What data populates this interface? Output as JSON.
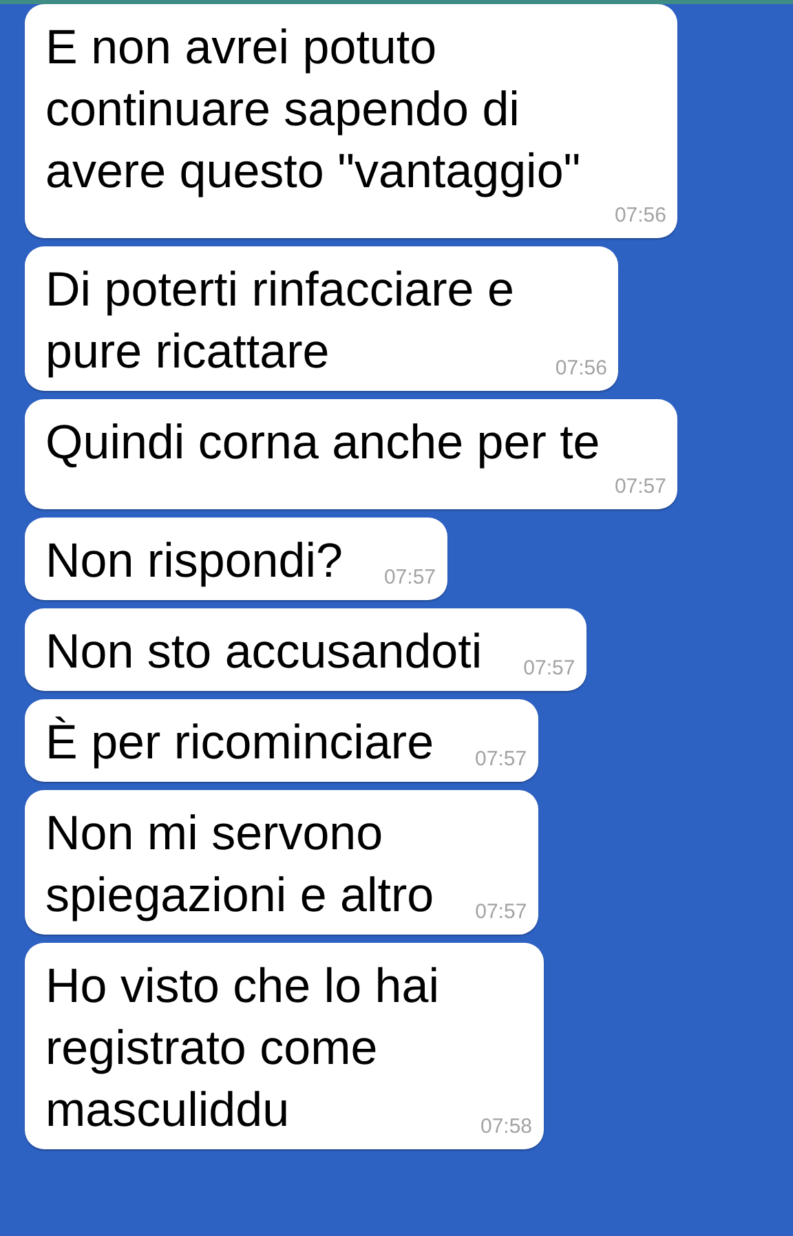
{
  "messages": [
    {
      "lines": [
        "E non avrei potuto",
        "continuare sapendo di",
        "avere questo \"vantaggio\""
      ],
      "time": "07:56"
    },
    {
      "lines": [
        "Di poterti rinfacciare e",
        "pure ricattare"
      ],
      "time": "07:56"
    },
    {
      "lines": [
        "Quindi corna anche per te"
      ],
      "time": "07:57"
    },
    {
      "lines": [
        "Non rispondi?"
      ],
      "time": "07:57"
    },
    {
      "lines": [
        "Non sto accusandoti"
      ],
      "time": "07:57"
    },
    {
      "lines": [
        "È per ricominciare"
      ],
      "time": "07:57"
    },
    {
      "lines": [
        "Non mi servono",
        "spiegazioni e altro"
      ],
      "time": "07:57"
    },
    {
      "lines": [
        "Ho visto che lo hai",
        "registrato come",
        "masculiddu"
      ],
      "time": "07:58"
    }
  ]
}
